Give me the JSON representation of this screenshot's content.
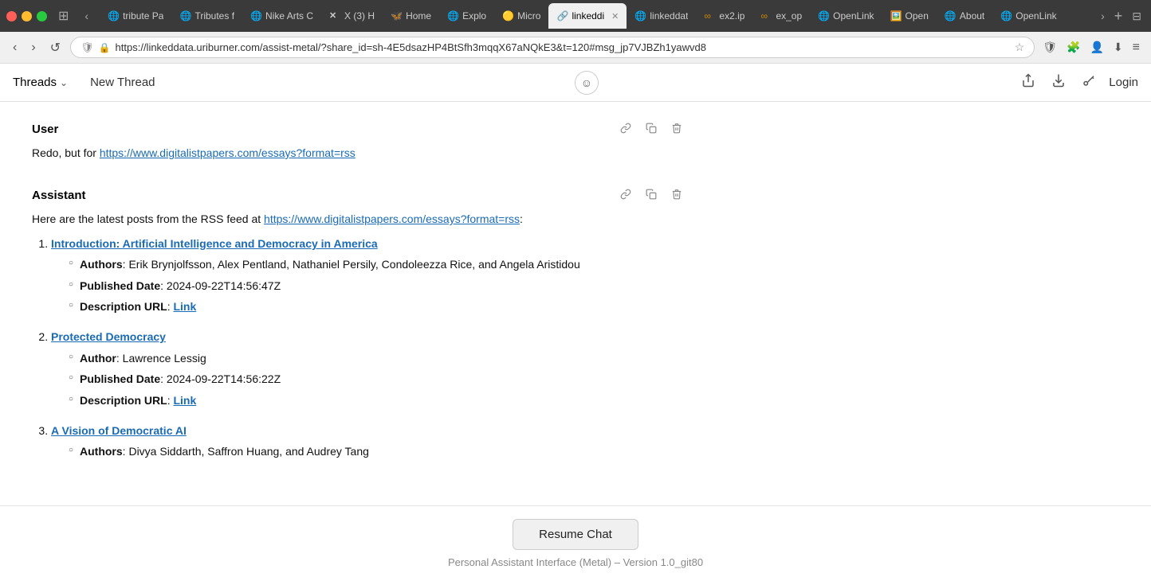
{
  "browser": {
    "tabs": [
      {
        "id": "tab1",
        "title": "ribute Pa",
        "favicon": "🌐",
        "active": false
      },
      {
        "id": "tab2",
        "title": "Tributes f",
        "favicon": "🌐",
        "active": false
      },
      {
        "id": "tab3",
        "title": "Nike Arts C",
        "favicon": "🌐",
        "active": false
      },
      {
        "id": "tab4",
        "title": "X (3) H",
        "favicon": "✕",
        "active": false
      },
      {
        "id": "tab5",
        "title": "Home",
        "favicon": "🦋",
        "active": false
      },
      {
        "id": "tab6",
        "title": "Explo",
        "favicon": "🌐",
        "active": false
      },
      {
        "id": "tab7",
        "title": "Micro",
        "favicon": "🟡",
        "active": false
      },
      {
        "id": "tab8",
        "title": "linkeddi",
        "favicon": "🔗",
        "active": true,
        "closable": true
      },
      {
        "id": "tab9",
        "title": "linkeddat",
        "favicon": "🌐",
        "active": false
      },
      {
        "id": "tab10",
        "title": "ex2.ip",
        "favicon": "∞",
        "active": false
      },
      {
        "id": "tab11",
        "title": "ex_op",
        "favicon": "∞",
        "active": false
      },
      {
        "id": "tab12",
        "title": "OpenLink",
        "favicon": "🌐",
        "active": false
      },
      {
        "id": "tab13",
        "title": "Open",
        "favicon": "🖼️",
        "active": false
      },
      {
        "id": "tab14",
        "title": "About",
        "favicon": "🌐",
        "active": false
      },
      {
        "id": "tab15",
        "title": "OpenLink",
        "favicon": "🌐",
        "active": false
      }
    ],
    "url": "https://linkeddata.uriburner.com/assist-metal/?share_id=sh-4E5dsazHP4BtSfh3mqqX67aNQkE3&t=120#msg_jp7VJBZh1yawvd8"
  },
  "header": {
    "threads_label": "Threads",
    "new_thread_label": "New Thread",
    "login_label": "Login"
  },
  "user_message": {
    "role": "User",
    "text_prefix": "Redo, but for ",
    "link_text": "https://www.digitalistpapers.com/essays?format=rss",
    "link_href": "https://www.digitalistpapers.com/essays?format=rss"
  },
  "assistant_message": {
    "role": "Assistant",
    "intro_prefix": "Here are the latest posts from the RSS feed at ",
    "rss_link_text": "https://www.digitalistpapers.com/essays?format=rss",
    "rss_link_href": "https://www.digitalistpapers.com/essays?format=rss",
    "intro_suffix": ":",
    "posts": [
      {
        "number": 1,
        "title": "Introduction: Artificial Intelligence and Democracy in America",
        "url": "#",
        "authors_label": "Authors",
        "authors_value": "Erik Brynjolfsson, Alex Pentland, Nathaniel Persily, Condoleezza Rice, and Angela Aristidou",
        "published_label": "Published Date",
        "published_value": "2024-09-22T14:56:47Z",
        "desc_url_label": "Description URL",
        "desc_url_text": "Link",
        "desc_url_href": "#"
      },
      {
        "number": 2,
        "title": "Protected Democracy",
        "url": "#",
        "authors_label": "Author",
        "authors_value": "Lawrence Lessig",
        "published_label": "Published Date",
        "published_value": "2024-09-22T14:56:22Z",
        "desc_url_label": "Description URL",
        "desc_url_text": "Link",
        "desc_url_href": "#"
      },
      {
        "number": 3,
        "title": "A Vision of Democratic AI",
        "url": "#",
        "authors_label": "Authors",
        "authors_value": "Divya Siddarth, Saffron Huang, and Audrey Tang",
        "published_label": "",
        "published_value": "",
        "desc_url_label": "",
        "desc_url_text": "",
        "desc_url_href": "#"
      }
    ]
  },
  "bottom": {
    "resume_chat_label": "Resume Chat",
    "version_text": "Personal Assistant Interface (Metal) – Version 1.0_git80"
  },
  "icons": {
    "back": "‹",
    "forward": "›",
    "reload": "↺",
    "shield": "🛡",
    "lock": "🔒",
    "star": "★",
    "shield_check": "🛡",
    "extension": "🧩",
    "profile": "👤",
    "download": "⬇",
    "menu": "≡",
    "share": "⬆",
    "key": "🔑",
    "link": "🔗",
    "copy": "⧉",
    "trash": "🗑",
    "smiley": "☺",
    "chevron_down": "⌄"
  }
}
